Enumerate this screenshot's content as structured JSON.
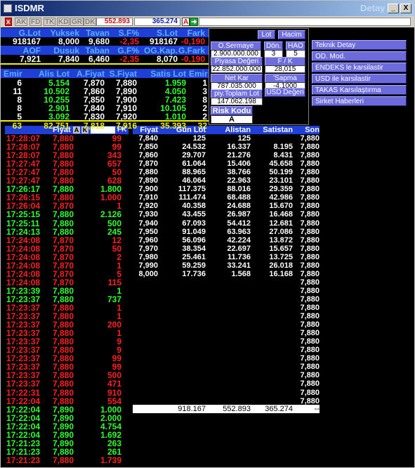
{
  "window": {
    "title": "ISDMR",
    "detay": "Detay"
  },
  "toolbar": {
    "close": "x",
    "buttons": [
      "AK",
      "FD",
      "TK",
      "KD",
      "GR",
      "DK"
    ],
    "value1": "552.893",
    "value2": "365.274",
    "a_label": "A"
  },
  "top_table": {
    "row1_headers": [
      "G.Lot",
      "Yuksek",
      "Tavan",
      "S.F%",
      "S.Lot",
      "Fark"
    ],
    "row1_values": [
      "918167",
      "8,000",
      "9,680",
      "-2,35",
      "918167",
      "-0,190"
    ],
    "row2_headers": [
      "AOF",
      "Dusuk",
      "Taban",
      "G.F%",
      "OG.Kap.",
      "G.Fark"
    ],
    "row2_values": [
      "7,921",
      "7,840",
      "6,460",
      "-2,35",
      "8,070",
      "-0,190"
    ]
  },
  "depth": {
    "headers": [
      "Emir",
      "Alis Lot",
      "A.Fiyat",
      "S.Fiyat",
      "Satis Lot",
      "Emir"
    ],
    "rows": [
      [
        "6",
        "5.154",
        "7,870",
        "7,880",
        "1.959",
        "1"
      ],
      [
        "11",
        "10.502",
        "7,860",
        "7,890",
        "4.050",
        "3"
      ],
      [
        "8",
        "10.255",
        "7,850",
        "7,900",
        "7.423",
        "8"
      ],
      [
        "8",
        "2.901",
        "7,840",
        "7,910",
        "10.105",
        "2"
      ],
      [
        "5",
        "3.092",
        "7,830",
        "7,920",
        "1.010",
        "2"
      ]
    ],
    "totals": [
      "63",
      "82.751",
      "7,818",
      "7,916",
      "35.393",
      "32"
    ]
  },
  "popup": {
    "lot": "Lot",
    "hacim": "Hacim",
    "osermaye": "O.Sermaye",
    "osermaye_val": "2.900.000.000",
    "don": "Dön.",
    "don_val": "3",
    "hao": "HAO",
    "hao_val": "5",
    "piyasa": "Piyasa Değeri",
    "piyasa_val": "22.852.000.000",
    "fk": "F / K",
    "fk_val": "28,015",
    "netkar": "Net Kar",
    "netkar_val": "787.035.000",
    "sapma": "'Sapma",
    "sapma_val": "-4,1000",
    "piytoplam": "piy.Toplam Lot",
    "piytoplam_val": "147.062.198",
    "usd": "USD Değeri",
    "risk": "Risk Kodu",
    "risk_val": "A"
  },
  "side_menu": [
    "Teknik Detay",
    "OD. Mod.",
    "ENDEKS le karsilastir",
    "USD ile karsilastir",
    "TAKAS Karsılaştırma",
    "Sirket Haberleri"
  ],
  "trades": {
    "header": "Fiyat",
    "btn_a": "A",
    "btn_k": "K",
    "btn_fk": "FK",
    "rows": [
      [
        "17:28:07",
        "7,880",
        "99",
        "r"
      ],
      [
        "17:28:07",
        "7,880",
        "99",
        "r"
      ],
      [
        "17:28:07",
        "7,880",
        "343",
        "r"
      ],
      [
        "17:27:47",
        "7,880",
        "657",
        "r"
      ],
      [
        "17:27:47",
        "7,880",
        "50",
        "r"
      ],
      [
        "17:27:47",
        "7,880",
        "628",
        "r"
      ],
      [
        "17:26:17",
        "7,880",
        "1.800",
        "g"
      ],
      [
        "17:26:15",
        "7,880",
        "1.000",
        "r"
      ],
      [
        "17:26:04",
        "7,870",
        "1",
        "r"
      ],
      [
        "17:25:15",
        "7,880",
        "2.126",
        "g"
      ],
      [
        "17:25:11",
        "7,880",
        "500",
        "g"
      ],
      [
        "17:24:13",
        "7,880",
        "245",
        "g"
      ],
      [
        "17:24:08",
        "7,870",
        "12",
        "r"
      ],
      [
        "17:24:08",
        "7,870",
        "50",
        "r"
      ],
      [
        "17:24:08",
        "7,870",
        "2",
        "r"
      ],
      [
        "17:24:08",
        "7,870",
        "1",
        "r"
      ],
      [
        "17:24:08",
        "7,870",
        "5",
        "r"
      ],
      [
        "17:24:08",
        "7,870",
        "115",
        "r"
      ],
      [
        "17:23:39",
        "7,880",
        "1",
        "g"
      ],
      [
        "17:23:37",
        "7,880",
        "737",
        "g"
      ],
      [
        "17:23:37",
        "7,880",
        "1",
        "r"
      ],
      [
        "17:23:37",
        "7,880",
        "1",
        "r"
      ],
      [
        "17:23:37",
        "7,880",
        "200",
        "r"
      ],
      [
        "17:23:37",
        "7,880",
        "1",
        "r"
      ],
      [
        "17:23:37",
        "7,880",
        "9",
        "r"
      ],
      [
        "17:23:37",
        "7,880",
        "9",
        "r"
      ],
      [
        "17:23:37",
        "7,880",
        "99",
        "r"
      ],
      [
        "17:23:37",
        "7,880",
        "99",
        "r"
      ],
      [
        "17:23:37",
        "7,880",
        "500",
        "r"
      ],
      [
        "17:23:37",
        "7,880",
        "471",
        "r"
      ],
      [
        "17:22:31",
        "7,880",
        "910",
        "r"
      ],
      [
        "17:22:04",
        "7,880",
        "554",
        "r"
      ],
      [
        "17:22:04",
        "7,890",
        "1.000",
        "g"
      ],
      [
        "17:22:04",
        "7,890",
        "2.000",
        "g"
      ],
      [
        "17:22:04",
        "7,890",
        "4.754",
        "g"
      ],
      [
        "17:22:04",
        "7,890",
        "1.692",
        "g"
      ],
      [
        "17:21:23",
        "7,890",
        "263",
        "g"
      ],
      [
        "17:21:23",
        "7,880",
        "261",
        "g"
      ],
      [
        "17:21:23",
        "7,880",
        "1.739",
        "r"
      ]
    ]
  },
  "distribution": {
    "headers": [
      "Fiyat",
      "Gun Lot",
      "Alistan",
      "Satistan",
      "Son"
    ],
    "rows": [
      [
        "7,840",
        "125",
        "125",
        "",
        ""
      ],
      [
        "7,850",
        "24.532",
        "16.337",
        "8.195",
        ""
      ],
      [
        "7,860",
        "29.707",
        "21.276",
        "8.431",
        ""
      ],
      [
        "7,870",
        "61.064",
        "15.406",
        "45.658",
        ""
      ],
      [
        "7,880",
        "88.965",
        "38.766",
        "50.199",
        ""
      ],
      [
        "7,890",
        "46.064",
        "22.963",
        "23.101",
        ""
      ],
      [
        "7,900",
        "117.375",
        "88.016",
        "29.359",
        ""
      ],
      [
        "7,910",
        "111.474",
        "68.488",
        "42.986",
        ""
      ],
      [
        "7,920",
        "40.358",
        "24.688",
        "15.670",
        ""
      ],
      [
        "7,930",
        "43.455",
        "26.987",
        "16.468",
        ""
      ],
      [
        "7,940",
        "67.093",
        "54.412",
        "12.681",
        ""
      ],
      [
        "7,950",
        "91.049",
        "63.963",
        "27.086",
        ""
      ],
      [
        "7,960",
        "56.096",
        "42.224",
        "13.872",
        ""
      ],
      [
        "7,970",
        "38.354",
        "22.697",
        "15.657",
        ""
      ],
      [
        "7,980",
        "25.461",
        "11.736",
        "13.725",
        ""
      ],
      [
        "7,990",
        "59.259",
        "33.241",
        "26.018",
        ""
      ],
      [
        "8,000",
        "17.736",
        "1.568",
        "16.168",
        ""
      ]
    ],
    "son_values": [
      "7,880",
      "7,880",
      "7,880",
      "7,880",
      "7,880",
      "7,880",
      "7,880",
      "7,880",
      "7,880",
      "7,880",
      "7,880",
      "7,880",
      "7,880",
      "7,880",
      "7,880",
      "7,880",
      "7,880",
      "7,880",
      "7,880",
      "7,880",
      "7,880",
      "7,880",
      "7,880",
      "7,880",
      "7,880",
      "7,880",
      "7,880",
      "7,880",
      "7,880",
      "7,880",
      "7,880",
      "7,880",
      "7,880"
    ],
    "totals": [
      "918.167",
      "552.893",
      "365.274",
      "--"
    ]
  }
}
